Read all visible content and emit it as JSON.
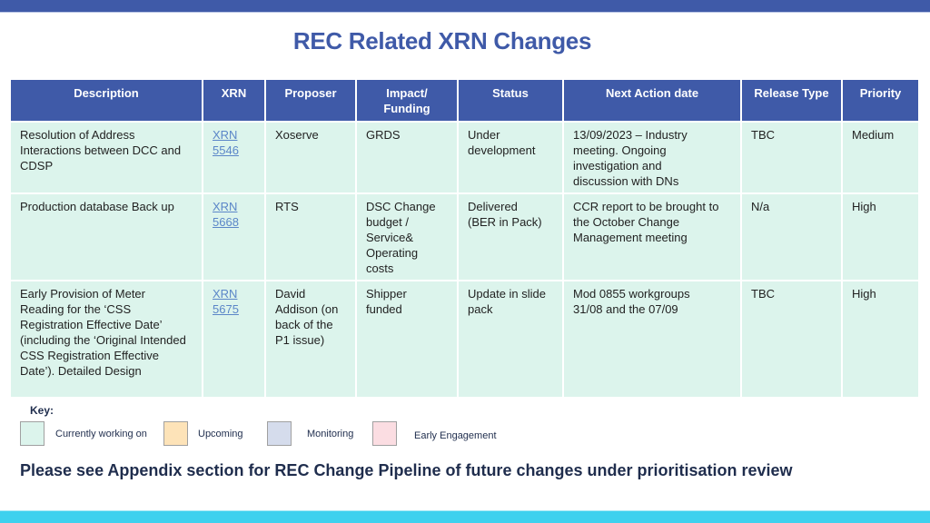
{
  "title": "REC Related XRN Changes",
  "table": {
    "headers": [
      "Description",
      "XRN",
      "Proposer",
      "Impact/ Funding",
      "Status",
      "Next Action date",
      "Release Type",
      "Priority"
    ],
    "rows": [
      {
        "description": "Resolution of Address Interactions between DCC and CDSP",
        "xrn_line1": "XRN",
        "xrn_line2": "5546",
        "proposer": "Xoserve",
        "impact_funding": "GRDS",
        "status": "Under development",
        "next_action": "13/09/2023 – Industry meeting. Ongoing investigation and discussion with DNs",
        "release_type": "TBC",
        "priority": "Medium",
        "category": "Currently working on"
      },
      {
        "description": "Production database Back up",
        "xrn_line1": "XRN",
        "xrn_line2": "5668",
        "proposer": "RTS",
        "impact_funding": "DSC Change budget / Service& Operating costs",
        "status": "Delivered (BER in Pack)",
        "next_action": "CCR report to be brought to the October Change Management meeting",
        "release_type": "N/a",
        "priority": "High",
        "category": "Currently working on"
      },
      {
        "description": "Early Provision of Meter Reading for the ‘CSS Registration Effective Date’ (including the ‘Original Intended CSS Registration Effective Date’). Detailed Design",
        "xrn_line1": "XRN",
        "xrn_line2": "5675",
        "proposer": "David Addison (on back of the P1 issue)",
        "impact_funding": "Shipper funded",
        "status": "Update in slide pack",
        "next_action": "Mod 0855 workgroups 31/08 and the 07/09",
        "release_type": "TBC",
        "priority": "High",
        "category": "Currently working on"
      }
    ]
  },
  "key": {
    "label": "Key:",
    "items": [
      {
        "label": "Currently working on",
        "color": "#dcf4ec"
      },
      {
        "label": "Upcoming",
        "color": "#fde3b8"
      },
      {
        "label": "Monitoring",
        "color": "#d5dcec"
      },
      {
        "label": "Early Engagement",
        "color": "#fbdde2"
      }
    ]
  },
  "footnote": "Please see Appendix section for REC Change Pipeline of future changes under prioritisation review",
  "colors": {
    "brand_blue": "#3f5aa8",
    "accent_cyan": "#3ed1ee",
    "row_green": "#dcf4ec",
    "link": "#5b86c8"
  }
}
